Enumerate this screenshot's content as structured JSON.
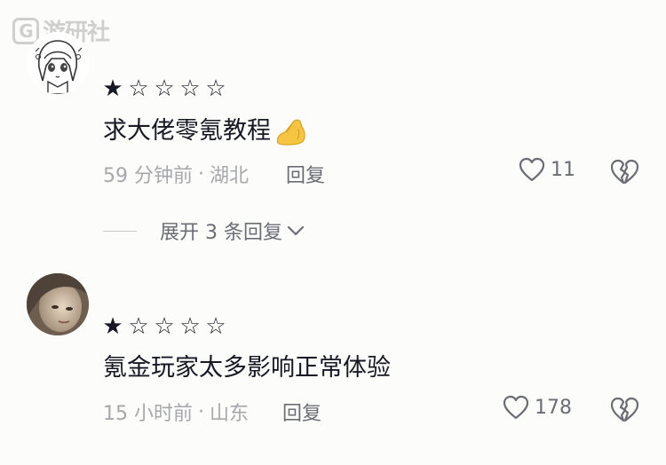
{
  "watermark": {
    "text": "游研社"
  },
  "comments": [
    {
      "rating_filled": 1,
      "rating_total": 5,
      "text": "求大佬零氪教程",
      "time": "59 分钟前",
      "location": "湖北",
      "reply_label": "回复",
      "likes": "11",
      "expand_label": "展开 3 条回复"
    },
    {
      "rating_filled": 1,
      "rating_total": 5,
      "text": "氪金玩家太多影响正常体验",
      "time": "15 小时前",
      "location": "山东",
      "reply_label": "回复",
      "likes": "178"
    }
  ],
  "separator": "·",
  "colors": {
    "background": "#fcfcfa",
    "text_primary": "#161823",
    "text_secondary": "#a7a8ad",
    "text_action": "#6b6d75"
  },
  "icons": {
    "star_filled": "★",
    "star_empty": "☆",
    "like": "heart-outline",
    "dislike": "broken-heart",
    "expand": "chevron-down",
    "emoji": "pinched-fingers-hand"
  }
}
